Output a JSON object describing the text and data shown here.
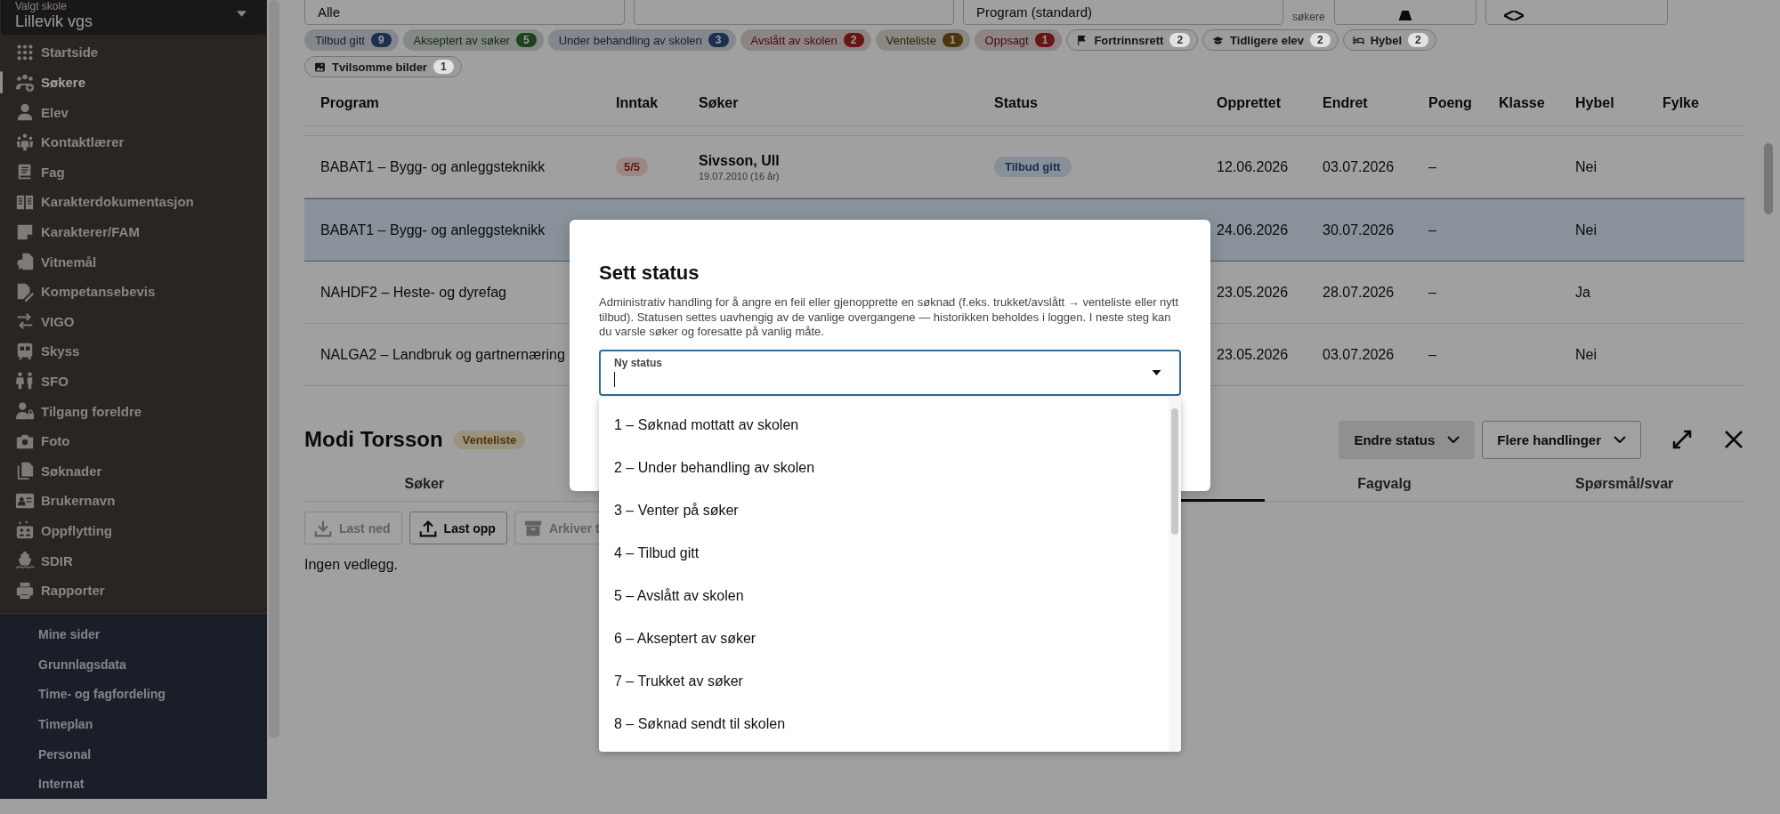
{
  "sidebar": {
    "school_select": {
      "label": "Valgt skole",
      "value": "Lillevik vgs"
    },
    "items": [
      {
        "label": "Startside",
        "selected": false
      },
      {
        "label": "Søkere",
        "selected": true
      },
      {
        "label": "Elev",
        "selected": false
      },
      {
        "label": "Kontaktlærer",
        "selected": false
      },
      {
        "label": "Fag",
        "selected": false
      },
      {
        "label": "Karakterdokumentasjon",
        "selected": false
      },
      {
        "label": "Karakterer/FAM",
        "selected": false
      },
      {
        "label": "Vitnemål",
        "selected": false
      },
      {
        "label": "Kompetansebevis",
        "selected": false
      },
      {
        "label": "VIGO",
        "selected": false
      },
      {
        "label": "Skyss",
        "selected": false
      },
      {
        "label": "SFO",
        "selected": false
      },
      {
        "label": "Tilgang foreldre",
        "selected": false
      },
      {
        "label": "Foto",
        "selected": false
      },
      {
        "label": "Søknader",
        "selected": false
      },
      {
        "label": "Brukernavn",
        "selected": false
      },
      {
        "label": "Oppflytting",
        "selected": false
      },
      {
        "label": "SDIR",
        "selected": false
      },
      {
        "label": "Rapporter",
        "selected": false
      }
    ],
    "secondary_items": [
      "Mine sider",
      "Grunnlagsdata",
      "Time- og fagfordeling",
      "Timeplan",
      "Personal",
      "Internat"
    ]
  },
  "filters": {
    "fields": [
      {
        "value": "Alle"
      },
      {
        "value": "Program (standard)"
      }
    ],
    "label": "søkere"
  },
  "chips": [
    {
      "kind": "status",
      "label": "Tilbud gitt",
      "count": "9",
      "color": "#1b304f"
    },
    {
      "kind": "status",
      "label": "Akseptert av søker",
      "count": "5",
      "color": "#1d431e"
    },
    {
      "kind": "status",
      "label": "Under behandling av skolen",
      "count": "3",
      "color": "#1b304f"
    },
    {
      "kind": "status",
      "label": "Avslått av skolen",
      "count": "2",
      "color": "#671614"
    },
    {
      "kind": "status",
      "label": "Venteliste",
      "count": "1",
      "color": "#4d360b"
    },
    {
      "kind": "status",
      "label": "Oppsagt",
      "count": "1",
      "color": "#671614"
    },
    {
      "kind": "flag",
      "label": "Fortrinnsrett",
      "count": "2"
    },
    {
      "kind": "flag",
      "label": "Tidligere elev",
      "count": "2"
    },
    {
      "kind": "flag",
      "label": "Hybel",
      "count": "2"
    },
    {
      "kind": "flag",
      "label": "Tvilsomme bilder",
      "count": "1"
    }
  ],
  "table": {
    "columns": [
      "Program",
      "Inntak",
      "Søker",
      "Status",
      "Opprettet",
      "Endret",
      "Poeng",
      "Klasse",
      "Hybel",
      "Fylke"
    ],
    "rows": [
      {
        "selected": false,
        "program": "BABAT1 – Bygg- og anleggsteknikk",
        "intake": "5/5",
        "applicant": "Sivsson, Ull",
        "birth": "19.07.2010 (16 år)",
        "status": "Tilbud gitt",
        "created": "12.06.2026",
        "changed": "03.07.2026",
        "points": "–",
        "housing": "Nei"
      },
      {
        "selected": true,
        "program": "BABAT1 – Bygg- og anleggsteknikk",
        "created": "24.06.2026",
        "changed": "30.07.2026",
        "points": "–",
        "housing": "Nei"
      },
      {
        "selected": false,
        "program": "NAHDF2 – Heste- og dyrefag",
        "created": "23.05.2026",
        "changed": "28.07.2026",
        "points": "–",
        "housing": "Ja"
      },
      {
        "selected": false,
        "program": "NALGA2 – Landbruk og gartnernæring",
        "created": "23.05.2026",
        "changed": "03.07.2026",
        "points": "–",
        "housing": "Nei"
      }
    ]
  },
  "detail": {
    "name": "Modi Torsson",
    "status": "Venteliste",
    "actions": [
      "Endre status",
      "Flere handlinger"
    ],
    "tabs": [
      "Søker",
      "Fagvalg",
      "Spørsmål/svar"
    ],
    "toolbar": [
      {
        "label": "Last ned",
        "disabled": true
      },
      {
        "label": "Last opp",
        "disabled": false
      },
      {
        "label": "Arkiver t",
        "disabled": true
      }
    ],
    "empty_text": "Ingen vedlegg."
  },
  "modal": {
    "title": "Sett status",
    "text": "Administrativ handling for å angre en feil eller gjenopprette en søknad (f.eks. trukket/avslått → venteliste eller nytt tilbud). Statusen settes uavhengig av de vanlige overgangene — historikken beholdes i loggen. I neste steg kan du varsle søker og foresatte på vanlig måte.",
    "field": {
      "label": "Ny status"
    },
    "options": [
      "1 – Søknad mottatt av skolen",
      "2 – Under behandling av skolen",
      "3 – Venter på søker",
      "4 – Tilbud gitt",
      "5 – Avslått av skolen",
      "6 – Akseptert av søker",
      "7 – Trukket av søker",
      "8 – Søknad sendt til skolen"
    ]
  }
}
